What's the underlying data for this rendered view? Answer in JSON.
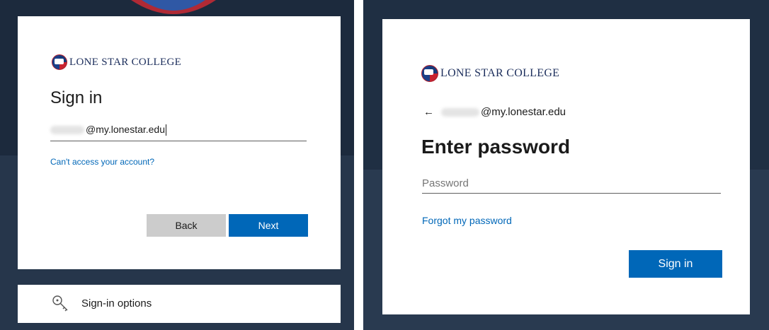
{
  "left_panel": {
    "logo_text": "LONE STAR COLLEGE",
    "title": "Sign in",
    "email_value": "@my.lonestar.edu",
    "link": "Can't access your account?",
    "back_label": "Back",
    "next_label": "Next",
    "options_label": "Sign-in options",
    "options_icon": "key-icon"
  },
  "right_panel": {
    "logo_text": "LONE STAR COLLEGE",
    "back_arrow": "←",
    "email": "@my.lonestar.edu",
    "title": "Enter password",
    "password_placeholder": "Password",
    "link": "Forgot my password",
    "signin_label": "Sign in"
  },
  "colors": {
    "accent": "#0067b8",
    "secondary_button": "#cccccc",
    "background": "#1c2a3d"
  }
}
